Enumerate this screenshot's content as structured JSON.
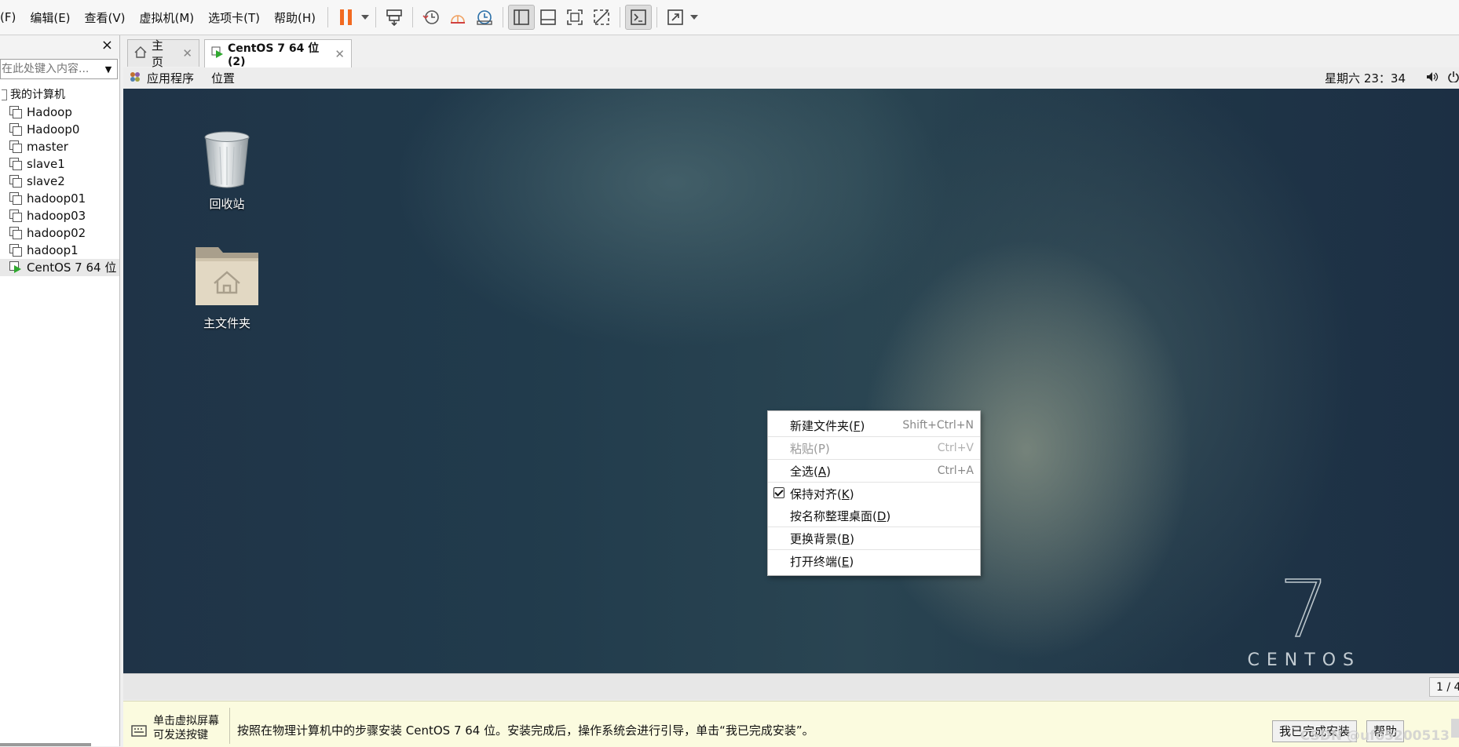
{
  "menubar": {
    "items": [
      "(F)",
      "编辑(E)",
      "查看(V)",
      "虚拟机(M)",
      "选项卡(T)",
      "帮助(H)"
    ]
  },
  "toolbar": {
    "icons": [
      "pause-icon",
      "send-keys-icon",
      "snapshot-take-icon",
      "snapshot-revert-icon",
      "snapshot-manager-icon",
      "view-library-icon",
      "view-thumbnail-icon",
      "fullscreen-icon",
      "unity-icon",
      "console-icon",
      "stretch-icon"
    ],
    "accent_color": "#f26a21"
  },
  "library": {
    "search_placeholder": "在此处键入内容...",
    "root_label": "我的计算机",
    "items": [
      "Hadoop",
      "Hadoop0",
      "master",
      "slave1",
      "slave2",
      "hadoop01",
      "hadoop03",
      "hadoop02",
      "hadoop1",
      "CentOS 7 64 位"
    ],
    "selected": "CentOS 7 64 位"
  },
  "tabs": [
    {
      "label": "主页",
      "active": false
    },
    {
      "label": "CentOS 7 64 位 (2)",
      "active": true
    }
  ],
  "guest": {
    "panel": {
      "applications": "应用程序",
      "places": "位置",
      "clock": "星期六 23：34"
    },
    "desktop_icons": [
      {
        "label": "回收站",
        "icon": "trash-icon"
      },
      {
        "label": "主文件夹",
        "icon": "home-folder-icon"
      }
    ],
    "context_menu": [
      {
        "label": "新建文件夹(",
        "mnemonic": "F",
        "accel": "Shift+Ctrl+N",
        "disabled": false
      },
      {
        "label": "粘贴(P)",
        "mnemonic": "",
        "accel": "Ctrl+V",
        "disabled": true
      },
      {
        "label": "全选(",
        "mnemonic": "A",
        "accel": "Ctrl+A",
        "disabled": false
      },
      {
        "label": "保持对齐(",
        "mnemonic": "K",
        "accel": "",
        "checked": true
      },
      {
        "label": "按名称整理桌面(",
        "mnemonic": "D",
        "accel": ""
      },
      {
        "label": "更换背景(",
        "mnemonic": "B",
        "accel": ""
      },
      {
        "label": "打开终端(",
        "mnemonic": "E",
        "accel": ""
      }
    ],
    "logo": {
      "numeral": "7",
      "text": "CENTOS"
    },
    "page_indicator": "1 / 4"
  },
  "hint_bar": {
    "left_line1": "单击虚拟屏幕",
    "left_line2": "可发送按键",
    "message": "按照在物理计算机中的步骤安装 CentOS 7 64 位。安装完成后，操作系统会进行引导，单击“我已完成安装”。",
    "done_button": "我已完成安装",
    "help_button": "帮助"
  },
  "watermark": "CSDN @ufo5200513"
}
